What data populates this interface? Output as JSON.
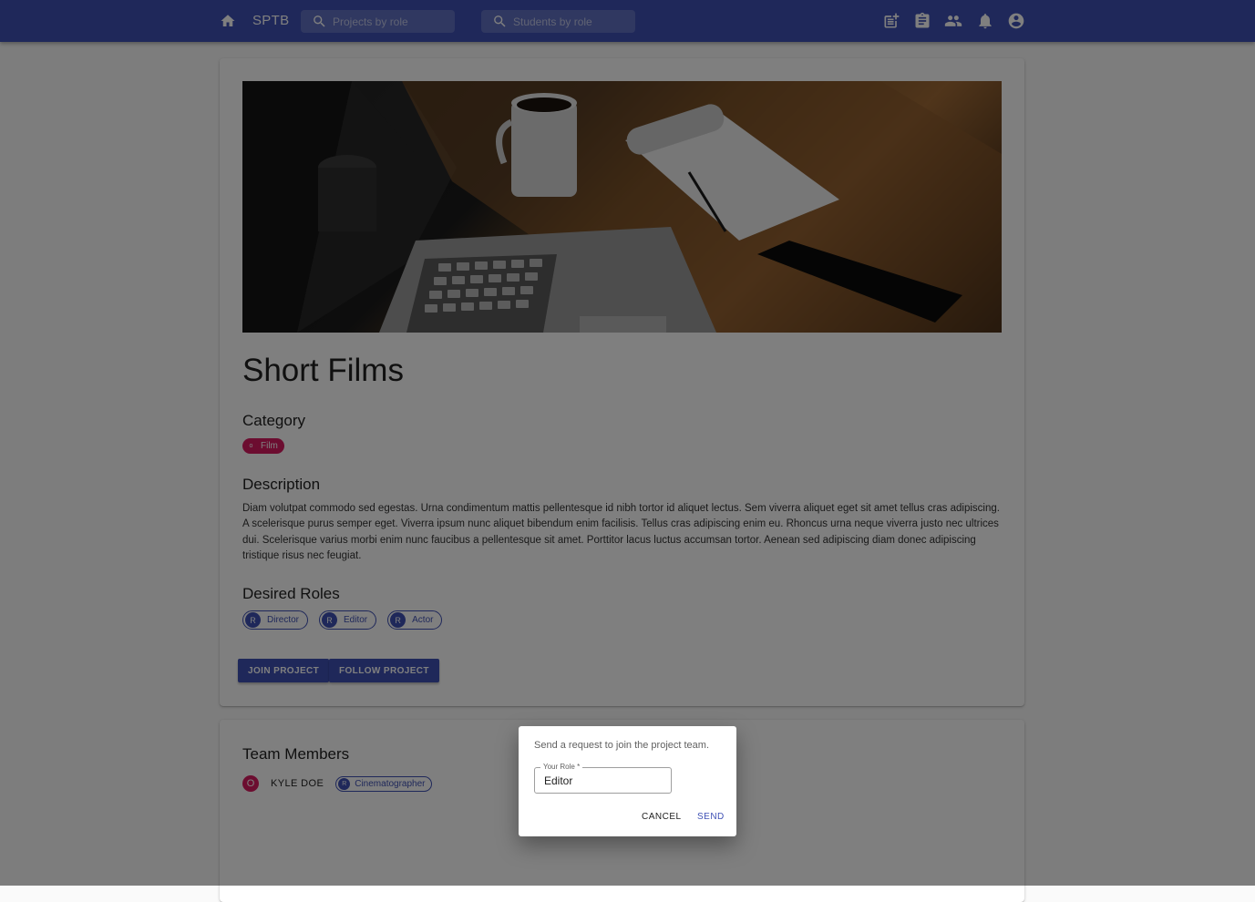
{
  "appbar": {
    "brand": "SPTB",
    "search_projects_placeholder": "Projects by role",
    "search_students_placeholder": "Students by role",
    "icons": [
      "home-icon",
      "search-icon",
      "post-add-icon",
      "assignment-icon",
      "people-icon",
      "notifications-icon",
      "account-circle-icon"
    ],
    "color": "#3f51b5"
  },
  "project": {
    "title": "Short Films",
    "category_heading": "Category",
    "category_chip": {
      "avatar": "o",
      "label": "Film",
      "color": "#d81b60"
    },
    "description_heading": "Description",
    "description": "Diam volutpat commodo sed egestas. Urna condimentum mattis pellentesque id nibh tortor id aliquet lectus. Sem viverra aliquet eget sit amet tellus cras adipiscing. A scelerisque purus semper eget. Viverra ipsum nunc aliquet bibendum enim facilisis. Tellus cras adipiscing enim eu. Rhoncus urna neque viverra justo nec ultrices dui. Scelerisque varius morbi enim nunc faucibus a pellentesque sit amet. Porttitor lacus luctus accumsan tortor. Aenean sed adipiscing diam donec adipiscing tristique risus nec feugiat.",
    "roles_heading": "Desired Roles",
    "roles": [
      {
        "avatar": "R",
        "label": "Director"
      },
      {
        "avatar": "R",
        "label": "Editor"
      },
      {
        "avatar": "R",
        "label": "Actor"
      }
    ],
    "join_label": "JOIN PROJECT",
    "follow_label": "FOLLOW PROJECT"
  },
  "team": {
    "heading": "Team Members",
    "members": [
      {
        "avatar": "O",
        "name": "KYLE DOE",
        "role_avatar": "R",
        "role": "Cinematographer"
      }
    ]
  },
  "dialog": {
    "message": "Send a request to join the project team.",
    "field_label": "Your Role *",
    "field_value": "Editor",
    "cancel_label": "CANCEL",
    "send_label": "SEND",
    "send_color": "#3f51b5"
  }
}
